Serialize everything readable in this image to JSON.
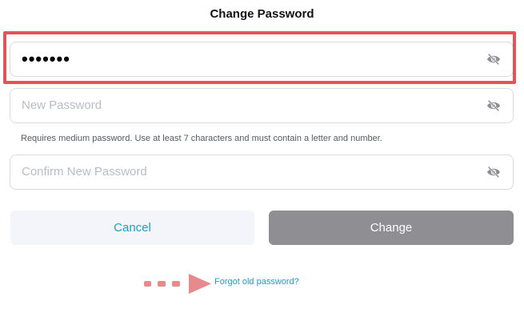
{
  "header": {
    "title": "Change Password"
  },
  "form": {
    "old_password": {
      "value": "•••••••",
      "visibility_icon": "eye-slash-icon"
    },
    "new_password": {
      "placeholder": "New Password",
      "visibility_icon": "eye-slash-icon"
    },
    "requirements_hint": "Requires medium password. Use at least 7 characters and must contain a letter and number.",
    "confirm_password": {
      "placeholder": "Confirm New Password",
      "visibility_icon": "eye-slash-icon"
    }
  },
  "actions": {
    "cancel_label": "Cancel",
    "change_label": "Change"
  },
  "forgot_link": "Forgot old password?",
  "annotations": {
    "highlight_color": "#e5525a",
    "arrow_color": "#e88a8c"
  },
  "colors": {
    "accent": "#1aa1c4",
    "disabled_button": "#8e8e93",
    "cancel_button_bg": "#f4f5fb"
  }
}
